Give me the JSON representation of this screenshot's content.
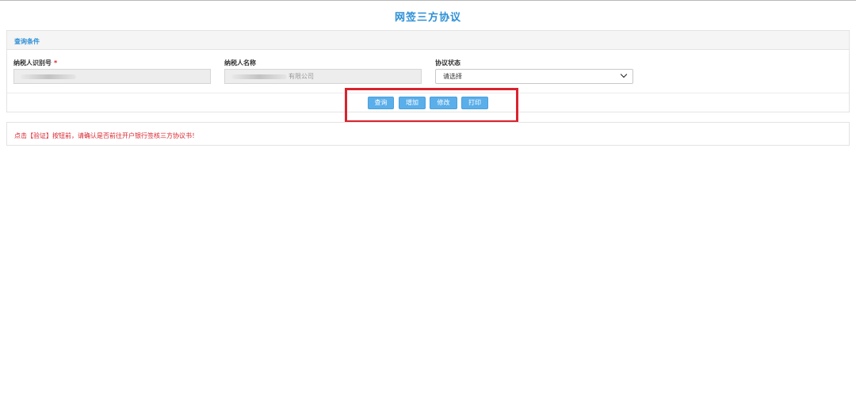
{
  "page": {
    "title": "网签三方协议"
  },
  "query_panel": {
    "header": "查询条件",
    "fields": [
      {
        "label": "纳税人识别号",
        "required_mark": "*",
        "value": ""
      },
      {
        "label": "纳税人名称",
        "value": "有限公司"
      },
      {
        "label": "协议状态",
        "selected": "请选择"
      }
    ]
  },
  "buttons": {
    "query": "查询",
    "add": "增加",
    "modify": "修改",
    "print": "打印"
  },
  "notice": {
    "text": "点击【验证】按钮前，请确认是否前往开户银行签核三方协议书！"
  },
  "colors": {
    "title": "#2c8fd6",
    "button": "#5aaeea",
    "highlight": "#d9232d",
    "notice": "#d9232d"
  }
}
